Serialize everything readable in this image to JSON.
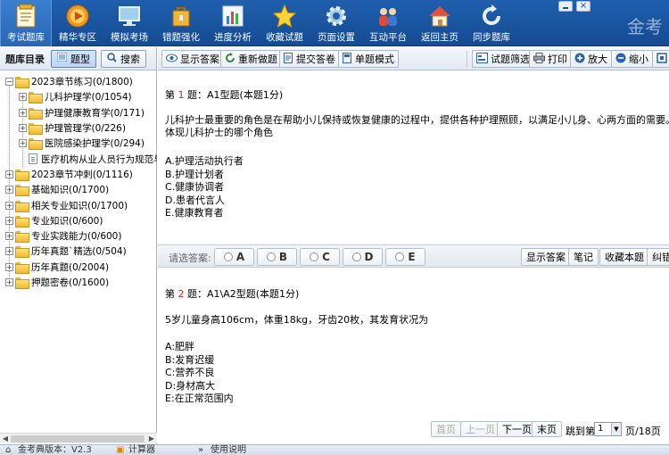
{
  "nav": [
    {
      "label": "考试题库",
      "icon": "exam-bank-icon",
      "active": true
    },
    {
      "label": "精华专区",
      "icon": "play-icon"
    },
    {
      "label": "模拟考场",
      "icon": "monitor-icon"
    },
    {
      "label": "错题强化",
      "icon": "bag-icon"
    },
    {
      "label": "进度分析",
      "icon": "bar-chart-icon"
    },
    {
      "label": "收藏试题",
      "icon": "star-icon"
    },
    {
      "label": "页面设置",
      "icon": "gear-icon"
    },
    {
      "label": "互动平台",
      "icon": "people-icon"
    },
    {
      "label": "返回主页",
      "icon": "home-icon"
    },
    {
      "label": "同步题库",
      "icon": "sync-icon"
    }
  ],
  "brand": "金考",
  "left": {
    "title": "题库目录",
    "btn_type": "题型",
    "btn_search": "搜索"
  },
  "tree": [
    {
      "label": "2023章节练习(0/1800)",
      "level": 0,
      "type": "folder",
      "exp": "-"
    },
    {
      "label": "儿科护理学(0/1054)",
      "level": 1,
      "type": "folder",
      "exp": "+"
    },
    {
      "label": "护理健康教育学(0/171)",
      "level": 1,
      "type": "folder",
      "exp": "+"
    },
    {
      "label": "护理管理学(0/226)",
      "level": 1,
      "type": "folder",
      "exp": "+"
    },
    {
      "label": "医院感染护理学(0/294)",
      "level": 1,
      "type": "folder",
      "exp": "+"
    },
    {
      "label": "医疗机构从业人员行为规范与医",
      "level": 1,
      "type": "doc",
      "exp": ""
    },
    {
      "label": "2023章节冲刺(0/1116)",
      "level": 0,
      "type": "folder",
      "exp": "+"
    },
    {
      "label": "基础知识(0/1700)",
      "level": 0,
      "type": "folder",
      "exp": "+"
    },
    {
      "label": "相关专业知识(0/1700)",
      "level": 0,
      "type": "folder",
      "exp": "+"
    },
    {
      "label": "专业知识(0/600)",
      "level": 0,
      "type": "folder",
      "exp": "+"
    },
    {
      "label": "专业实践能力(0/600)",
      "level": 0,
      "type": "folder",
      "exp": "+"
    },
    {
      "label": "历年真题`精选(0/504)",
      "level": 0,
      "type": "folder",
      "exp": "+"
    },
    {
      "label": "历年真题(0/2004)",
      "level": 0,
      "type": "folder",
      "exp": "+"
    },
    {
      "label": "押题密卷(0/1600)",
      "level": 0,
      "type": "folder",
      "exp": "+"
    }
  ],
  "toolbar": {
    "show_answer": "显示答案",
    "redo": "重新做题",
    "submit": "提交答卷",
    "single_mode": "单题模式",
    "filter": "试题筛选",
    "print": "打印",
    "zoom_in": "放大",
    "zoom_out": "缩小"
  },
  "q1": {
    "prefix": "第",
    "num": "1",
    "suffix": "题：A1型题(本题1分)",
    "stem1": "儿科护士最重要的角色是在帮助小儿保持或恢复健康的过程中，提供各种护理照顾，以满足小儿身、心两方面的需要。这",
    "stem2": "体现儿科护士的哪个角色",
    "options": [
      "A.护理活动执行者",
      "B.护理计划者",
      "C.健康协调者",
      "D.患者代言人",
      "E.健康教育者"
    ]
  },
  "answer_bar": {
    "label": "请选答案:",
    "choices": [
      "A",
      "B",
      "C",
      "D",
      "E"
    ],
    "show_answer": "显示答案",
    "notes": "笔记",
    "favorite": "收藏本题",
    "correct": "纠错"
  },
  "q2": {
    "prefix": "第",
    "num": "2",
    "suffix": "题：A1\\A2型题(本题1分)",
    "stem": "5岁儿童身高106cm，体重18kg，牙齿20枚，其发育状况为",
    "options": [
      "A:肥胖",
      "B:发育迟缓",
      "C:营养不良",
      "D:身材高大",
      "E:在正常范围内"
    ]
  },
  "pager": {
    "first": "首页",
    "prev": "上一页",
    "next": "下一页",
    "last": "末页",
    "jump_to": "跳到第",
    "page_value": "1",
    "total": "页/18页"
  },
  "status": {
    "version": "金考典版本：V2.3",
    "calculator": "计算器",
    "instructions": "使用说明"
  }
}
